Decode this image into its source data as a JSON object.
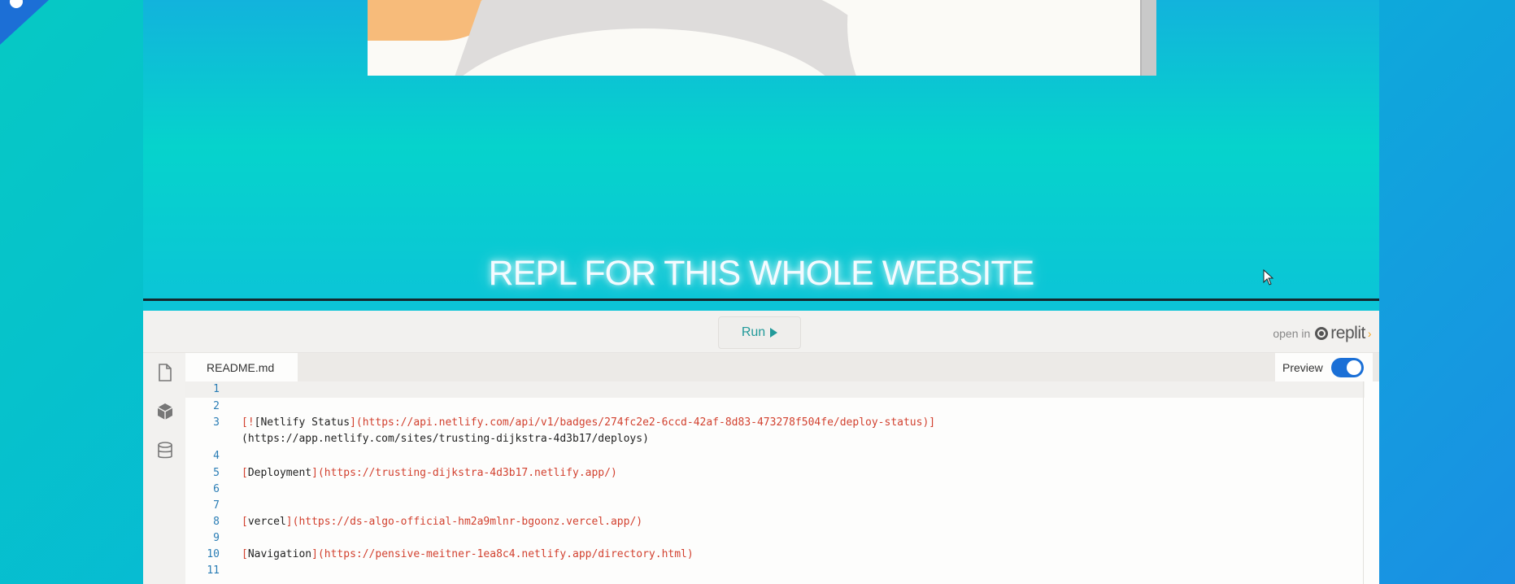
{
  "hero": {
    "title": "REPL FOR THIS WHOLE WEBSITE"
  },
  "embed": {
    "run_label": "Run",
    "open_in_label": "open in",
    "brand": "replit",
    "file_tab": "README.md",
    "preview_label": "Preview",
    "preview_on": true
  },
  "sidebar": {
    "icons": [
      "file-icon",
      "package-icon",
      "database-icon"
    ]
  },
  "code": {
    "lines": [
      {
        "n": "1",
        "text": ""
      },
      {
        "n": "2",
        "text": ""
      },
      {
        "n": "3",
        "text": "[![Netlify Status](https://api.netlify.com/api/v1/badges/274fc2e2-6ccd-42af-8d83-473278f504fe/deploy-status)]"
      },
      {
        "n": "",
        "text": "(https://app.netlify.com/sites/trusting-dijkstra-4d3b17/deploys)"
      },
      {
        "n": "4",
        "text": ""
      },
      {
        "n": "5",
        "text": "[Deployment](https://trusting-dijkstra-4d3b17.netlify.app/)"
      },
      {
        "n": "6",
        "text": ""
      },
      {
        "n": "7",
        "text": ""
      },
      {
        "n": "8",
        "text": "[vercel](https://ds-algo-official-hm2a9mlnr-bgoonz.vercel.app/)"
      },
      {
        "n": "9",
        "text": ""
      },
      {
        "n": "10",
        "text": "[Navigation](https://pensive-meitner-1ea8c4.netlify.app/directory.html)"
      },
      {
        "n": "11",
        "text": ""
      }
    ]
  },
  "colors": {
    "accent": "#229a9a",
    "toggle": "#1a6fd6",
    "link": "#d2412f",
    "line_number": "#2a7db5"
  }
}
